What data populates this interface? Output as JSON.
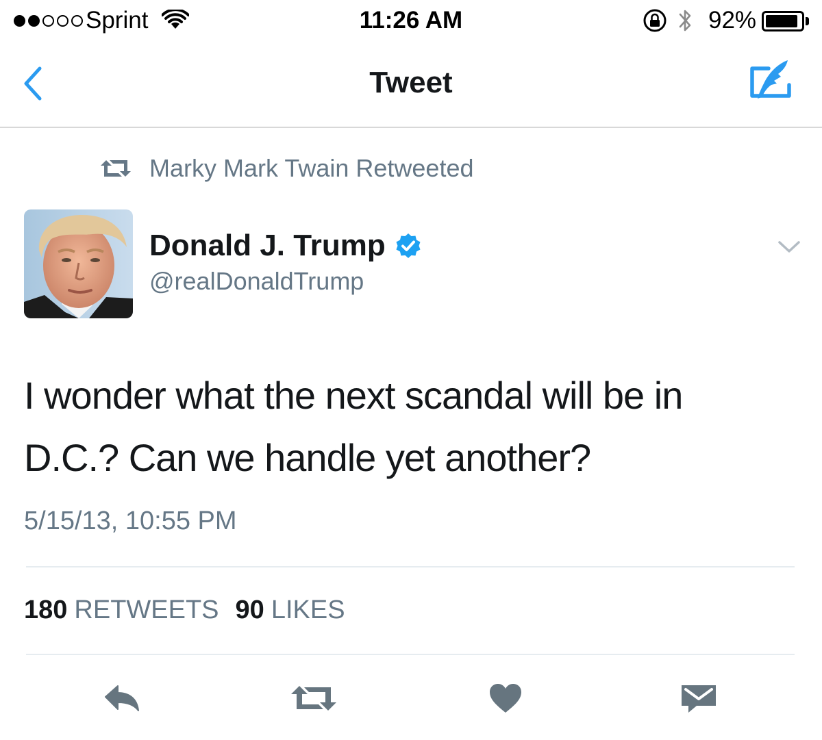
{
  "status_bar": {
    "carrier": "Sprint",
    "time": "11:26 AM",
    "battery_percent": "92%",
    "battery_level": 0.92,
    "signal_bars_filled": 2,
    "signal_bars_total": 5
  },
  "nav": {
    "title": "Tweet"
  },
  "retweet_context": {
    "text": "Marky Mark Twain Retweeted"
  },
  "author": {
    "name": "Donald J. Trump",
    "handle": "@realDonaldTrump",
    "verified": true
  },
  "tweet": {
    "line1": "I wonder what the next scandal will be in",
    "line2": "D.C.? Can we handle yet another?",
    "timestamp": "5/15/13, 10:55 PM"
  },
  "stats": {
    "retweets_count": "180",
    "retweets_label": "RETWEETS",
    "likes_count": "90",
    "likes_label": "LIKES"
  },
  "colors": {
    "accent": "#1da1f2",
    "nav_icon": "#2b9bf0",
    "secondary_text": "#657786",
    "action_icon": "#66757f"
  },
  "icons": {
    "back": "chevron-left-icon",
    "compose": "compose-tweet-icon",
    "retweet_context": "retweet-icon",
    "verified": "verified-badge-icon",
    "menu": "chevron-down-icon",
    "reply": "reply-icon",
    "retweet": "retweet-icon",
    "like": "heart-icon",
    "dm": "envelope-icon"
  }
}
